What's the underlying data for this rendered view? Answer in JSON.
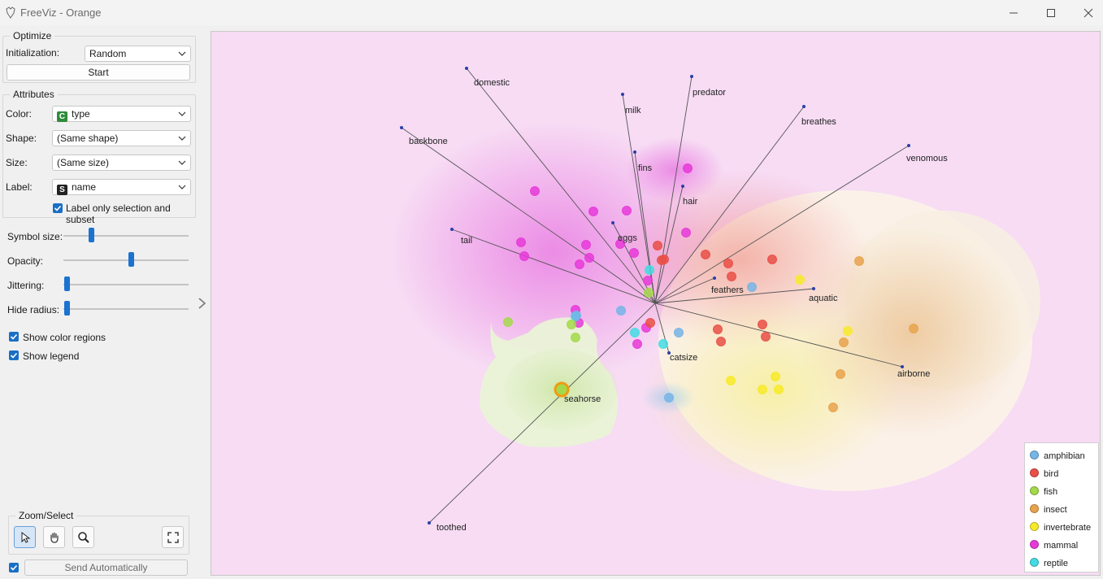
{
  "window": {
    "title": "FreeViz - Orange"
  },
  "optimize": {
    "title": "Optimize",
    "initialization_label": "Initialization:",
    "initialization_value": "Random",
    "start_label": "Start"
  },
  "attributes": {
    "title": "Attributes",
    "color_label": "Color:",
    "color_value": "type",
    "color_badge": "C",
    "color_badge_color": "#2e8b3a",
    "shape_label": "Shape:",
    "shape_value": "(Same shape)",
    "size_label": "Size:",
    "size_value": "(Same size)",
    "label_label": "Label:",
    "label_value": "name",
    "label_badge": "S",
    "label_badge_color": "#222222",
    "label_only_selection": "Label only selection and subset"
  },
  "sliders": {
    "symbol_size_label": "Symbol size:",
    "symbol_size_level": 0.25,
    "opacity_label": "Opacity:",
    "opacity_level": 0.55,
    "jittering_label": "Jittering:",
    "jittering_level": 0.0,
    "hide_radius_label": "Hide radius:",
    "hide_radius_level": 0.0
  },
  "checks": {
    "show_color_regions": "Show color regions",
    "show_legend": "Show legend"
  },
  "zoom_select": {
    "title": "Zoom/Select",
    "tools": [
      "pointer-icon",
      "hand-icon",
      "magnifier-icon",
      "fit-icon"
    ]
  },
  "send": {
    "label": "Send Automatically"
  },
  "anchors": [
    "domestic",
    "milk",
    "predator",
    "breathes",
    "venomous",
    "backbone",
    "fins",
    "hair",
    "tail",
    "eggs",
    "feathers",
    "aquatic",
    "airborne",
    "catsize",
    "toothed"
  ],
  "selected_label": "seahorse",
  "legend": [
    {
      "name": "amphibian",
      "color": "#76b5e6"
    },
    {
      "name": "bird",
      "color": "#e94f47"
    },
    {
      "name": "fish",
      "color": "#a3d94a"
    },
    {
      "name": "insect",
      "color": "#e8a34d"
    },
    {
      "name": "invertebrate",
      "color": "#f7ea2a"
    },
    {
      "name": "mammal",
      "color": "#e63ad8"
    },
    {
      "name": "reptile",
      "color": "#43dbe3"
    }
  ]
}
